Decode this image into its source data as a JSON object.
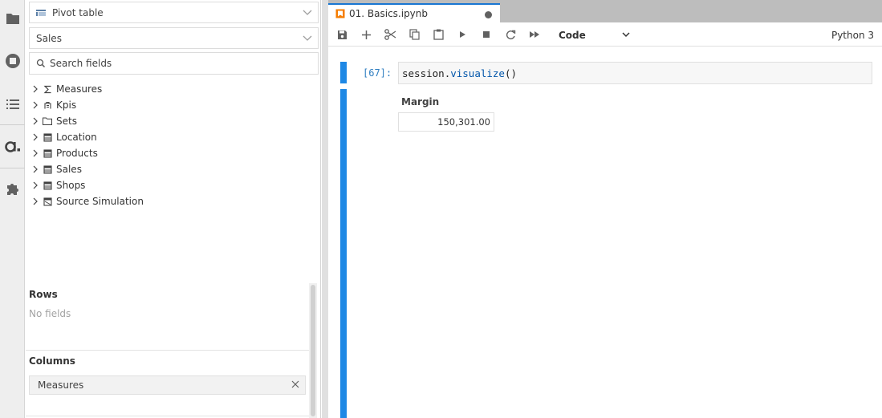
{
  "sidebar": {
    "icons": [
      "folder-icon",
      "running-icon",
      "toc-icon",
      "atoti-icon",
      "extension-icon"
    ]
  },
  "left_panel": {
    "widget_select": "Pivot table",
    "cube_select": "Sales",
    "search_placeholder": "Search fields",
    "tree": [
      {
        "label": "Measures",
        "icon": "sigma-icon"
      },
      {
        "label": "Kpis",
        "icon": "kpi-icon"
      },
      {
        "label": "Sets",
        "icon": "folder-icon"
      },
      {
        "label": "Location",
        "icon": "table-icon"
      },
      {
        "label": "Products",
        "icon": "table-icon"
      },
      {
        "label": "Sales",
        "icon": "table-icon"
      },
      {
        "label": "Shops",
        "icon": "table-icon"
      },
      {
        "label": "Source Simulation",
        "icon": "simulation-icon"
      }
    ],
    "rows": {
      "title": "Rows",
      "empty": "No fields"
    },
    "columns": {
      "title": "Columns",
      "chips": [
        "Measures"
      ]
    }
  },
  "tab": {
    "label": "01. Basics.ipynb"
  },
  "toolbar": {
    "cell_type": "Code",
    "kernel": "Python 3"
  },
  "cell": {
    "prompt": "[67]:",
    "code_obj": "session",
    "code_dot": ".",
    "code_fn": "visualize",
    "code_args": "()"
  },
  "output": {
    "header": "Margin",
    "value": "150,301.00"
  },
  "colors": {
    "accent": "#1e88e5",
    "tab_border": "#1976d2",
    "prompt": "#307fc1"
  }
}
